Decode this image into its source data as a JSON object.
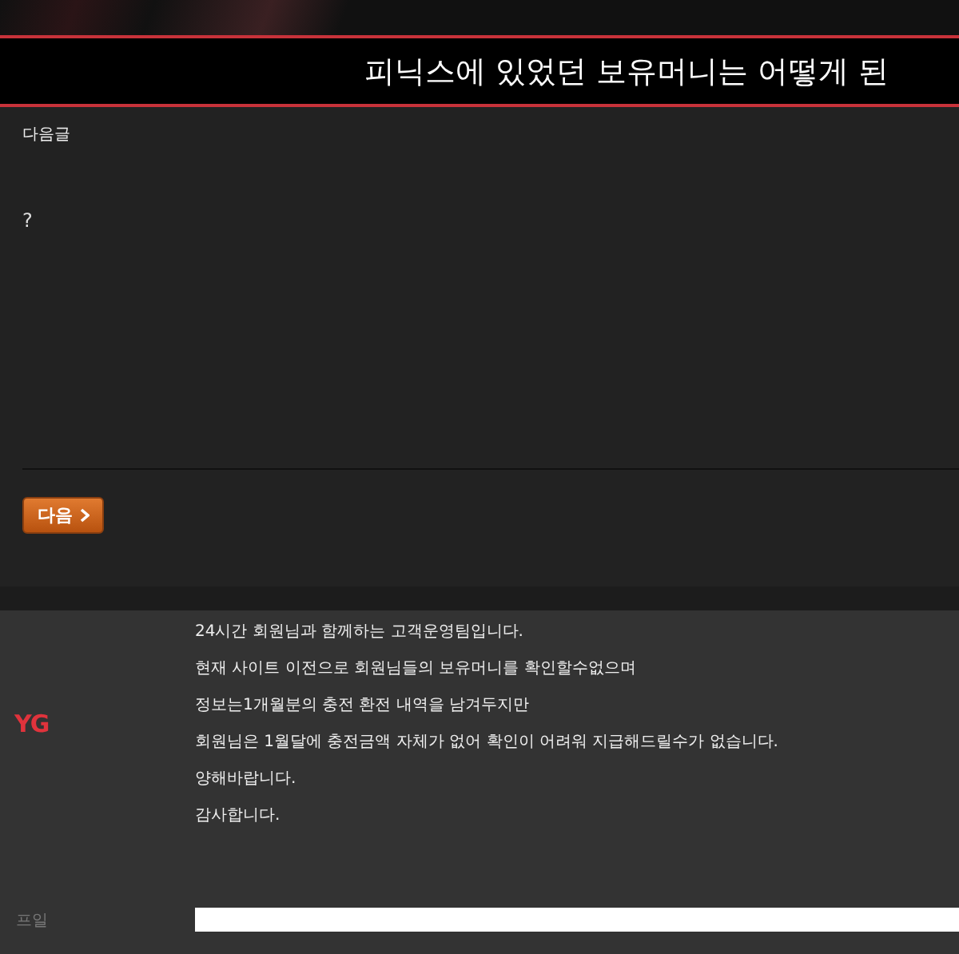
{
  "post": {
    "title": "피닉스에 있었던 보유머니는 어떻게 된",
    "nav_label": "다음글",
    "body": "?",
    "next_button": "다음"
  },
  "reply": {
    "logo": "YG",
    "lines": [
      "24시간 회원님과 함께하는 고객운영팀입니다.",
      "현재 사이트 이전으로 회원님들의 보유머니를 확인할수없으며",
      "정보는1개월분의 충전 환전 내역을  남겨두지만",
      "회원님은 1월달에 충전금액 자체가 없어 확인이 어려워 지급해드릴수가 없습니다.",
      "양해바랍니다.",
      "감사합니다."
    ]
  },
  "comment_form": {
    "label": "프일"
  }
}
